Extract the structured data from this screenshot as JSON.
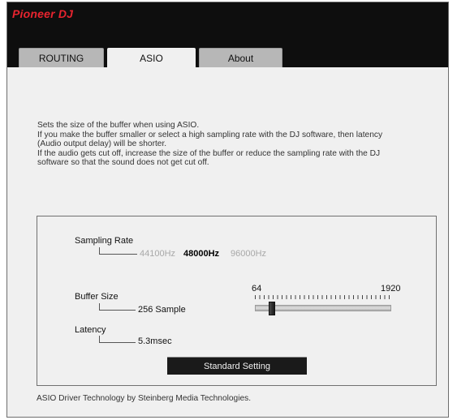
{
  "app": {
    "logo_text": "Pioneer DJ"
  },
  "tabs": [
    {
      "label": "ROUTING",
      "active": false
    },
    {
      "label": "ASIO",
      "active": true
    },
    {
      "label": "About",
      "active": false
    }
  ],
  "description": [
    "Sets the size of the buffer when using ASIO.",
    "If you make the buffer smaller or select a high sampling rate with the DJ software, then latency",
    "(Audio output delay) will be shorter.",
    "If the audio gets cut off, increase the size of the buffer or reduce the sampling rate with the DJ",
    "software so that the sound does not get cut off."
  ],
  "sampling_rate": {
    "label": "Sampling Rate",
    "options": [
      "44100Hz",
      "48000Hz",
      "96000Hz"
    ],
    "selected": "48000Hz"
  },
  "buffer_size": {
    "label": "Buffer Size",
    "value": "256 Sample",
    "slider_min": "64",
    "slider_max": "1920",
    "slider_level": 256
  },
  "latency": {
    "label": "Latency",
    "value": "5.3msec"
  },
  "standard_button": "Standard Setting",
  "footer": "ASIO Driver Technology by Steinberg Media Technologies.",
  "colors": {
    "brand_red": "#e8242f",
    "header_bg": "#0e0e0e",
    "window_bg": "#f0f0f0"
  }
}
